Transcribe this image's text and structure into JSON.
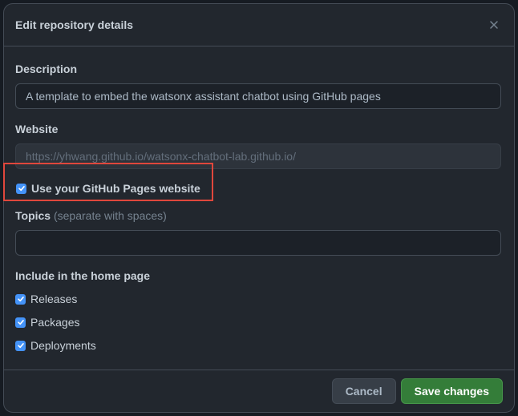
{
  "dialog": {
    "title": "Edit repository details",
    "close_icon": "x-icon"
  },
  "description": {
    "label": "Description",
    "value": "A template to embed the watsonx assistant chatbot using GitHub pages"
  },
  "website": {
    "label": "Website",
    "value": "https://yhwang.github.io/watsonx-chatbot-lab.github.io/",
    "use_pages_label": "Use your GitHub Pages website",
    "use_pages_checked": true
  },
  "topics": {
    "label": "Topics",
    "hint": "(separate with spaces)",
    "value": ""
  },
  "home_page": {
    "label": "Include in the home page",
    "options": [
      {
        "label": "Releases",
        "checked": true
      },
      {
        "label": "Packages",
        "checked": true
      },
      {
        "label": "Deployments",
        "checked": true
      }
    ]
  },
  "footer": {
    "cancel_label": "Cancel",
    "save_label": "Save changes"
  },
  "colors": {
    "accent": "#4493f8",
    "primary_button": "#347d39",
    "highlight_box": "#e0473c"
  }
}
